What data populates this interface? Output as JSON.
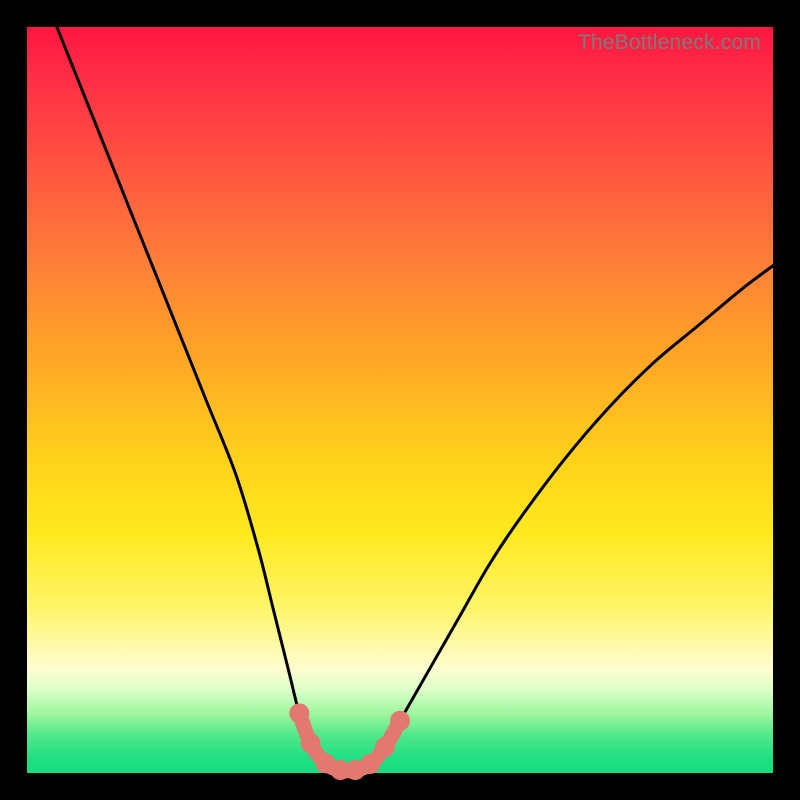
{
  "watermark": "TheBottleneck.com",
  "colors": {
    "frame": "#000000",
    "curve": "#000000",
    "marker": "#e2786f",
    "gradient_stops": [
      "#ff163f",
      "#ff7a3a",
      "#ffd21a",
      "#fffdd0",
      "#1fe083"
    ]
  },
  "chart_data": {
    "type": "line",
    "title": "",
    "xlabel": "",
    "ylabel": "",
    "xlim": [
      0,
      100
    ],
    "ylim": [
      0,
      100
    ],
    "series": [
      {
        "name": "bottleneck-curve",
        "x": [
          4,
          8,
          12,
          16,
          20,
          24,
          28,
          31,
          33,
          35,
          36.5,
          38,
          40,
          42,
          44,
          46,
          48,
          50,
          54,
          58,
          62,
          66,
          72,
          78,
          84,
          90,
          96,
          100
        ],
        "values": [
          100,
          90,
          80,
          70,
          60,
          50,
          40,
          30,
          22,
          14,
          8,
          4,
          1.3,
          0.4,
          0.4,
          1.2,
          3.5,
          7,
          14,
          21,
          28,
          34,
          42,
          49,
          55,
          60,
          65,
          68
        ]
      }
    ],
    "highlight": {
      "name": "sweet-spot",
      "x": [
        36.5,
        38,
        40,
        42,
        44,
        46,
        48,
        50
      ],
      "values": [
        8,
        4,
        1.3,
        0.4,
        0.4,
        1.2,
        3.5,
        7
      ]
    }
  }
}
